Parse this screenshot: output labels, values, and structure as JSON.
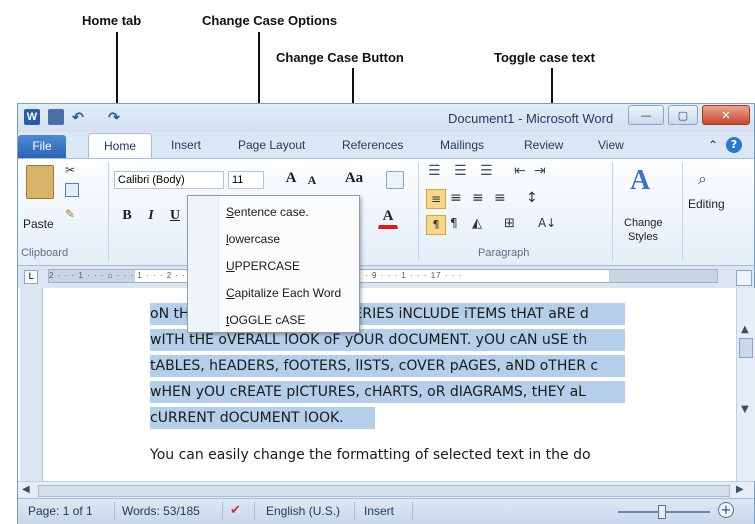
{
  "annotations": {
    "home_tab": "Home tab",
    "change_case_options": "Change Case Options",
    "change_case_button": "Change Case Button",
    "toggle_case_text": "Toggle case text"
  },
  "window": {
    "title": "Document1 - Microsoft Word",
    "word_icon": "W"
  },
  "tabs": {
    "file": "File",
    "home": "Home",
    "insert": "Insert",
    "page_layout": "Page Layout",
    "references": "References",
    "mailings": "Mailings",
    "review": "Review",
    "view": "View"
  },
  "ribbon": {
    "paste": "Paste",
    "clipboard": "Clipboard",
    "font_name": "Calibri (Body)",
    "font_size": "11",
    "grow_font": "A",
    "shrink_font": "A",
    "change_case": "Aa",
    "bold": "B",
    "italic": "I",
    "underline": "U",
    "font_color": "A",
    "paragraph": "Paragraph",
    "change_styles": "Change\nStyles",
    "change_styles_line1": "Change",
    "change_styles_line2": "Styles",
    "editing": "Editing"
  },
  "ruler_text": "2 · · · 1 · · · ⌂ · · · 1 · · · 2 · · · 3 · · · 4 · · · 5 · · · 6 · · · 7 · · · 8 · · · 9 · · · 1 · · · 17 · · ·",
  "document": {
    "lines": [
      "oN tHE iNSERT tAB, tHE gALLERIES iNCLUDE iTEMS tHAT aRE d",
      "wITH tHE oVERALL lOOK oF yOUR dOCUMENT. yOU cAN uSE th",
      "tABLES, hEADERS, fOOTERS, lISTS, cOVER pAGES, aND oTHER c",
      "wHEN yOU cREATE pICTURES, cHARTS, oR dIAGRAMS, tHEY aL",
      "cURRENT dOCUMENT lOOK."
    ],
    "normal_line": "You can easily change the formatting of selected text in the do"
  },
  "change_case_menu": {
    "items": [
      {
        "underlined": "S",
        "rest": "entence case."
      },
      {
        "underlined": "l",
        "rest": "owercase"
      },
      {
        "underlined": "U",
        "rest": "PPERCASE"
      },
      {
        "underlined": "C",
        "rest": "apitalize Each Word"
      },
      {
        "underlined": "t",
        "rest": "OGGLE cASE"
      }
    ]
  },
  "status": {
    "page": "Page: 1 of 1",
    "words": "Words: 53/185",
    "language": "English (U.S.)",
    "mode": "Insert"
  },
  "icons": [
    "word-icon",
    "save-icon",
    "undo-icon",
    "redo-icon",
    "help-icon",
    "paste-icon",
    "cut-icon",
    "copy-icon",
    "format-painter-icon",
    "bullets-icon",
    "numbering-icon",
    "align-left-icon",
    "find-icon",
    "styles-icon",
    "spell-check-icon",
    "zoom-in-icon"
  ]
}
